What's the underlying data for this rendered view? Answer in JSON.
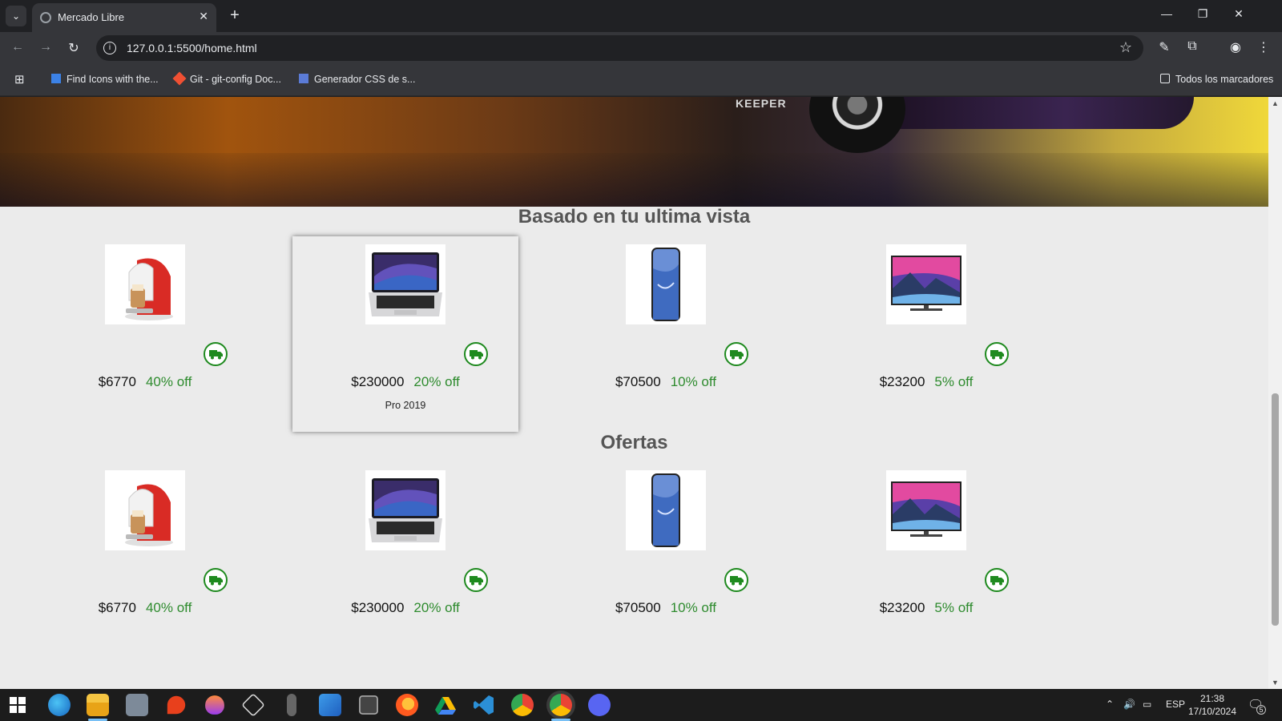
{
  "browser": {
    "tab_title": "Mercado Libre",
    "url": "127.0.0.1:5500/home.html",
    "bookmarks": [
      {
        "label": "Find Icons with the...",
        "color": "#3c82e6"
      },
      {
        "label": "Git - git-config Doc...",
        "color": "#f05033"
      },
      {
        "label": "Generador CSS de s...",
        "color": "#5b7bd6"
      }
    ],
    "all_bookmarks_label": "Todos los marcadores"
  },
  "hero": {
    "banner_text": "KEEPER"
  },
  "sections": [
    {
      "title": "Basado en tu ultima vista",
      "products": [
        {
          "name": "coffee-maker",
          "price": "$6770",
          "discount": "40% off",
          "model": ""
        },
        {
          "name": "laptop",
          "price": "$230000",
          "discount": "20% off",
          "model": "Pro 2019",
          "hovered": true
        },
        {
          "name": "smartphone",
          "price": "$70500",
          "discount": "10% off",
          "model": ""
        },
        {
          "name": "television",
          "price": "$23200",
          "discount": "5% off",
          "model": ""
        }
      ]
    },
    {
      "title": "Ofertas",
      "products": [
        {
          "name": "coffee-maker",
          "price": "$6770",
          "discount": "40% off",
          "model": ""
        },
        {
          "name": "laptop",
          "price": "$230000",
          "discount": "20% off",
          "model": ""
        },
        {
          "name": "smartphone",
          "price": "$70500",
          "discount": "10% off",
          "model": ""
        },
        {
          "name": "television",
          "price": "$23200",
          "discount": "5% off",
          "model": ""
        }
      ]
    }
  ],
  "colors": {
    "discount": "#2e8b2e",
    "shipping_icon": "#1f8a1f",
    "page_bg": "#ebebeb",
    "title": "#555555"
  },
  "taskbar": {
    "language": "ESP",
    "time": "21:38",
    "date": "17/10/2024",
    "notification_count": "5"
  }
}
